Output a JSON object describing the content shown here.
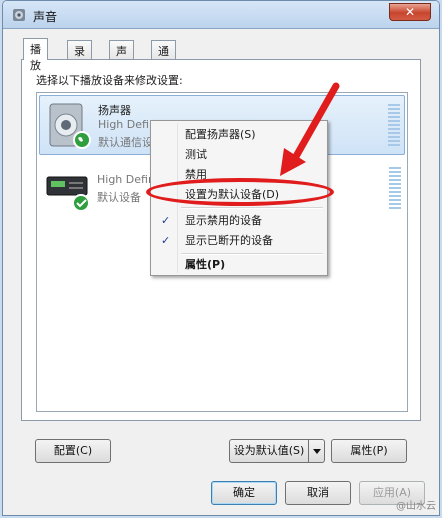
{
  "window": {
    "title": "声音",
    "close_glyph": "✕"
  },
  "tabs": [
    {
      "label": "播放",
      "active": true
    },
    {
      "label": "录制",
      "active": false
    },
    {
      "label": "声音",
      "active": false
    },
    {
      "label": "通信",
      "active": false
    }
  ],
  "instruction": "选择以下播放设备来修改设置:",
  "devices": [
    {
      "name": "扬声器",
      "description": "High Definit",
      "status": "默认通信设备",
      "icon": "speaker-icon",
      "badge": "phone-icon"
    },
    {
      "name": "",
      "description": "High Defini",
      "status": "默认设备",
      "icon": "hdmi-device-icon",
      "badge": "checkmark-icon"
    }
  ],
  "context_menu": {
    "items": [
      {
        "label": "配置扬声器(S)",
        "disabled": false,
        "checked": false,
        "bold": false
      },
      {
        "label": "测试",
        "disabled": false,
        "checked": false,
        "bold": false
      },
      {
        "label": "禁用",
        "disabled": false,
        "checked": false,
        "bold": false
      },
      {
        "label": "设置为默认设备(D)",
        "disabled": false,
        "checked": false,
        "bold": false
      },
      {
        "label": "显示禁用的设备",
        "disabled": false,
        "checked": true,
        "bold": false
      },
      {
        "label": "显示已断开的设备",
        "disabled": false,
        "checked": true,
        "bold": false
      },
      {
        "label": "属性(P)",
        "disabled": false,
        "checked": false,
        "bold": true
      }
    ],
    "check_glyph": "✓"
  },
  "buttons": {
    "configure": "配置(C)",
    "set_default": "设为默认值(S)",
    "properties": "属性(P)",
    "ok": "确定",
    "cancel": "取消",
    "apply": "应用(A)"
  },
  "watermark": "@山水云",
  "colors": {
    "annotation_red": "#e01c1c",
    "selection": "#cfe3f7"
  }
}
